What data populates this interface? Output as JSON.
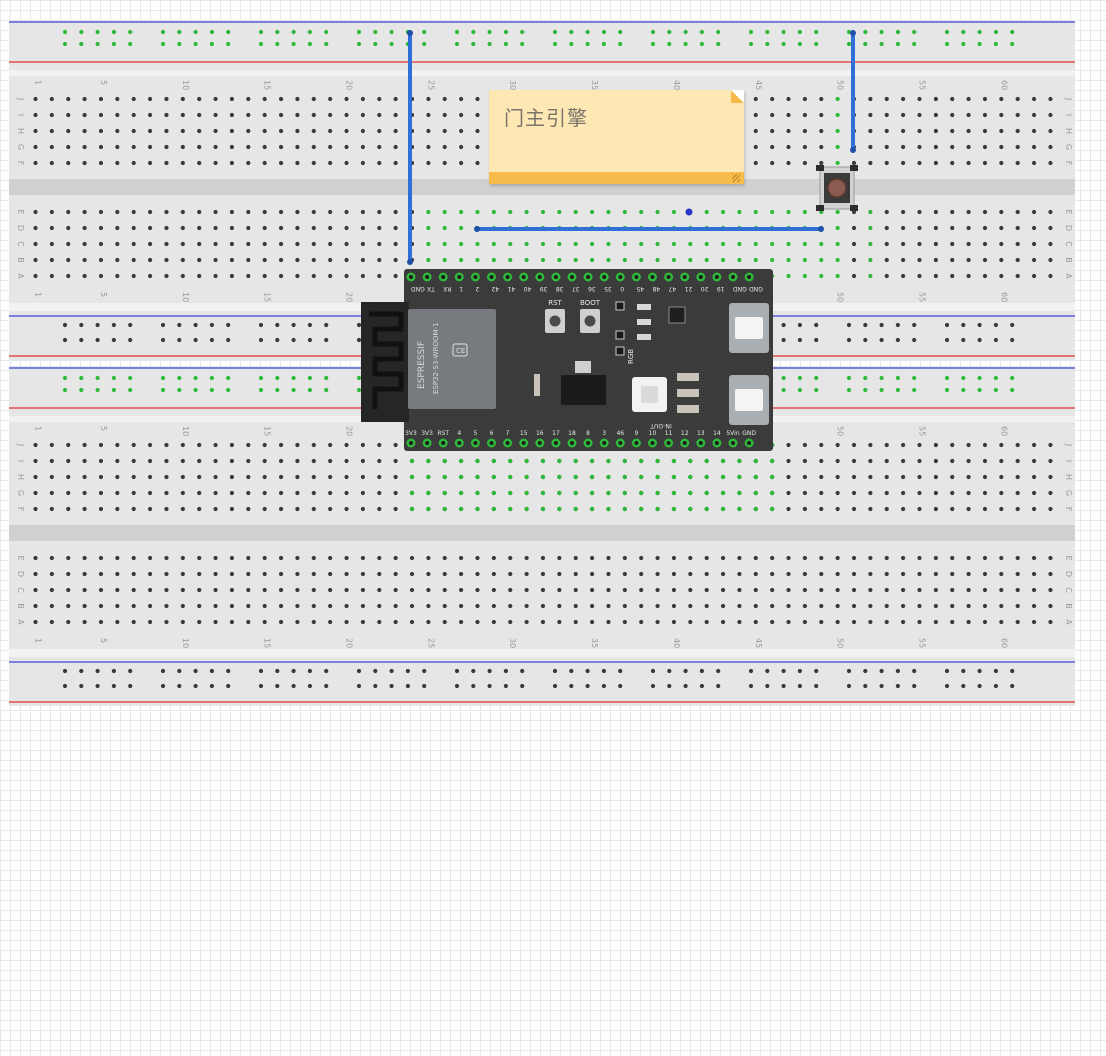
{
  "note": {
    "text": "门主引擎"
  },
  "breadboard": {
    "column_numbers": [
      "1",
      "5",
      "10",
      "15",
      "20",
      "25",
      "30",
      "35",
      "40",
      "45",
      "50",
      "55",
      "60"
    ],
    "upper_half": {
      "top_rows": [
        "J",
        "I",
        "H",
        "G",
        "F"
      ],
      "bottom_rows": [
        "E",
        "D",
        "C",
        "B",
        "A"
      ]
    },
    "lower_half": {
      "top_rows": [
        "J",
        "I",
        "H",
        "G",
        "F"
      ],
      "bottom_rows": [
        "E",
        "D",
        "C",
        "B",
        "A"
      ]
    },
    "colors": {
      "body": "#e6e6e6",
      "hole": "#3a3a3a",
      "hole_connected": "#2fb83a",
      "rail_red": "#e03131",
      "rail_blue": "#3a45d8",
      "wire": "#2f6fd6"
    }
  },
  "esp32": {
    "brand": "ESPRESSIF",
    "module": "ESP32-S3-WROOM-1",
    "top_pins": [
      "GND",
      "TX",
      "RX",
      "1",
      "2",
      "42",
      "41",
      "40",
      "39",
      "38",
      "37",
      "36",
      "35",
      "0",
      "45",
      "48",
      "47",
      "21",
      "20",
      "19",
      "GND",
      "GND"
    ],
    "bottom_pins": [
      "3V3",
      "3V3",
      "RST",
      "4",
      "5",
      "6",
      "7",
      "15",
      "16",
      "17",
      "18",
      "8",
      "3",
      "46",
      "9",
      "10",
      "11",
      "12",
      "13",
      "14",
      "5Vin",
      "GND"
    ],
    "button_labels": [
      "RST",
      "BOOT"
    ],
    "led_label": "RGB",
    "port_label": "IN-OUT",
    "colors": {
      "pcb": "#3b3b3b",
      "shield": "#777b7f",
      "antenna": "#262626"
    }
  },
  "pushbutton": {
    "cap_color": "#8b5a50"
  }
}
